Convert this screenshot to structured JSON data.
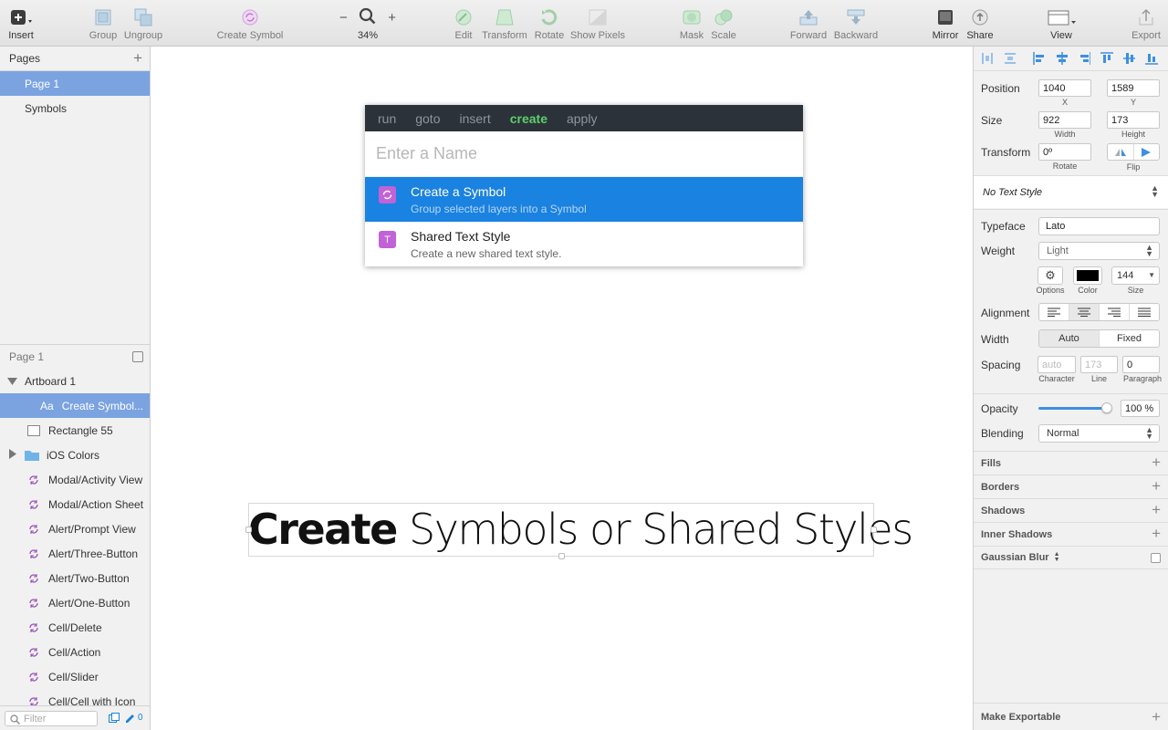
{
  "toolbar": {
    "insert": "Insert",
    "group": "Group",
    "ungroup": "Ungroup",
    "create_symbol": "Create Symbol",
    "zoom_level": "34%",
    "zoom_minus": "−",
    "zoom_plus": "+",
    "edit": "Edit",
    "transform": "Transform",
    "rotate": "Rotate",
    "show_pixels": "Show Pixels",
    "mask": "Mask",
    "scale": "Scale",
    "forward": "Forward",
    "backward": "Backward",
    "mirror": "Mirror",
    "share": "Share",
    "view": "View",
    "export": "Export"
  },
  "pages": {
    "title": "Pages",
    "add": "+",
    "items": [
      {
        "label": "Page 1",
        "selected": true
      },
      {
        "label": "Symbols",
        "selected": false
      }
    ]
  },
  "layers": {
    "header": "Page 1",
    "artboard": "Artboard 1",
    "items": [
      {
        "label": "Create Symbol...",
        "icon": "text-layer-icon",
        "prefix": "Aa",
        "selected": true
      },
      {
        "label": "Rectangle 55",
        "icon": "rectangle-icon"
      },
      {
        "label": "iOS Colors",
        "icon": "folder-icon"
      },
      {
        "label": "Modal/Activity View",
        "icon": "symbol-icon"
      },
      {
        "label": "Modal/Action Sheet",
        "icon": "symbol-icon"
      },
      {
        "label": "Alert/Prompt View",
        "icon": "symbol-icon"
      },
      {
        "label": "Alert/Three-Button",
        "icon": "symbol-icon"
      },
      {
        "label": "Alert/Two-Button",
        "icon": "symbol-icon"
      },
      {
        "label": "Alert/One-Button",
        "icon": "symbol-icon"
      },
      {
        "label": "Cell/Delete",
        "icon": "symbol-icon"
      },
      {
        "label": "Cell/Action",
        "icon": "symbol-icon"
      },
      {
        "label": "Cell/Slider",
        "icon": "symbol-icon"
      },
      {
        "label": "Cell/Cell with Icon",
        "icon": "symbol-icon"
      }
    ],
    "filter_placeholder": "Filter",
    "edit_count": "0"
  },
  "canvas": {
    "text_bold": "Create",
    "text_light": " Symbols or Shared Styles"
  },
  "runner": {
    "tabs": [
      {
        "label": "run",
        "active": false
      },
      {
        "label": "goto",
        "active": false
      },
      {
        "label": "insert",
        "active": false
      },
      {
        "label": "create",
        "active": true
      },
      {
        "label": "apply",
        "active": false
      }
    ],
    "placeholder": "Enter a Name",
    "options": [
      {
        "title": "Create a Symbol",
        "subtitle": "Group selected layers into a Symbol",
        "icon": "symbol-icon",
        "selected": true
      },
      {
        "title": "Shared Text Style",
        "subtitle": "Create a new shared text style.",
        "icon": "text-style-icon",
        "glyph": "T",
        "selected": false
      }
    ],
    "accent": "#5bd06a",
    "highlight": "#1a82e0"
  },
  "inspector": {
    "position_label": "Position",
    "x": "1040",
    "y": "1589",
    "x_label": "X",
    "y_label": "Y",
    "size_label": "Size",
    "width": "922",
    "height": "173",
    "width_label": "Width",
    "height_label": "Height",
    "transform_label": "Transform",
    "rotate_value": "0º",
    "rotate_label": "Rotate",
    "flip_label": "Flip",
    "text_style": "No Text Style",
    "typeface_label": "Typeface",
    "typeface": "Lato",
    "weight_label": "Weight",
    "weight": "Light",
    "options_label": "Options",
    "color_label": "Color",
    "font_size": "144",
    "size_sub_label": "Size",
    "alignment_label": "Alignment",
    "width_mode_label": "Width",
    "width_auto": "Auto",
    "width_fixed": "Fixed",
    "spacing_label": "Spacing",
    "character_ph": "auto",
    "line_ph": "173",
    "paragraph": "0",
    "character_label": "Character",
    "line_label": "Line",
    "paragraph_label": "Paragraph",
    "opacity_label": "Opacity",
    "opacity": "100 %",
    "opacity_fraction": 1.0,
    "blending_label": "Blending",
    "blending": "Normal",
    "fills": "Fills",
    "borders": "Borders",
    "shadows": "Shadows",
    "inner_shadows": "Inner Shadows",
    "gaussian_blur": "Gaussian Blur",
    "make_exportable": "Make Exportable",
    "text_color": "#000000"
  }
}
